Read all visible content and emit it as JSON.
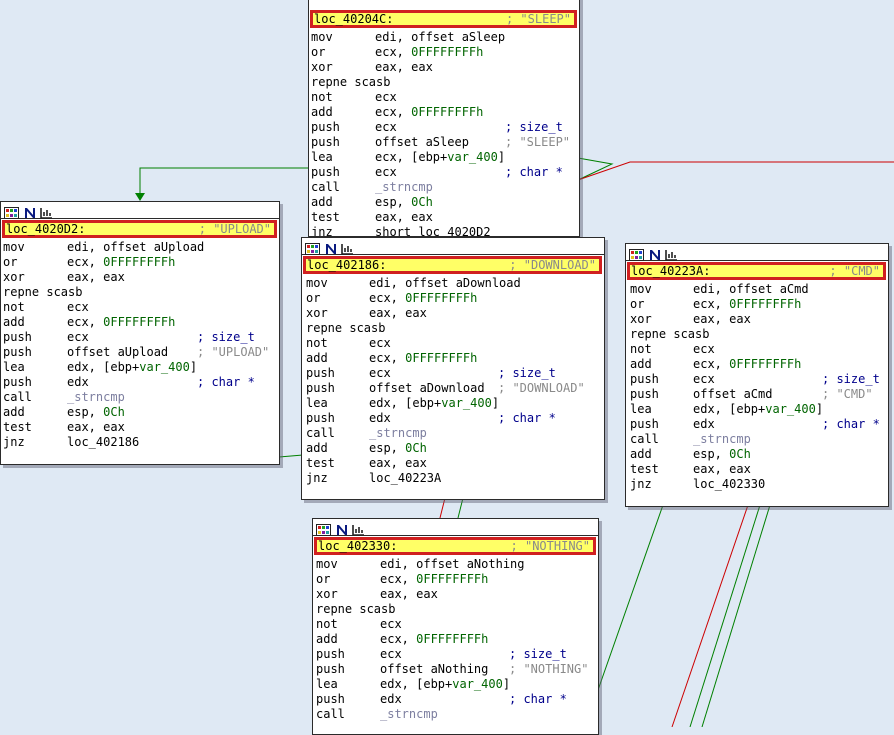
{
  "colors": {
    "background": "#dfe9f4",
    "label_highlight": "#ffff66",
    "label_border": "#d02020",
    "comment": "#8a8a8a",
    "constant": "#006400",
    "function": "#7d7fa0",
    "edge_true": "#008000",
    "edge_false": "#cc0000"
  },
  "header_icons": [
    "palette-icon",
    "n-icon",
    "graph-icon"
  ],
  "nodes": {
    "sleep": {
      "label": "loc_40204C:",
      "comment": "; \"SLEEP\"",
      "lines": [
        {
          "mn": "mov",
          "op": "edi, offset aSleep",
          "cm": ""
        },
        {
          "mn": "or",
          "op": "ecx, 0FFFFFFFFh",
          "cm": ""
        },
        {
          "mn": "xor",
          "op": "eax, eax",
          "cm": ""
        },
        {
          "mn": "repne scasb",
          "op": "",
          "cm": ""
        },
        {
          "mn": "not",
          "op": "ecx",
          "cm": ""
        },
        {
          "mn": "add",
          "op": "ecx, 0FFFFFFFFh",
          "cm": ""
        },
        {
          "mn": "push",
          "op": "ecx",
          "cm": "; size_t"
        },
        {
          "mn": "push",
          "op": "offset aSleep",
          "cm": "; \"SLEEP\""
        },
        {
          "mn": "lea",
          "op": "ecx, [ebp+var_400]",
          "cm": ""
        },
        {
          "mn": "push",
          "op": "ecx",
          "cm": "; char *"
        },
        {
          "mn": "call",
          "op": "_strncmp",
          "cm": ""
        },
        {
          "mn": "add",
          "op": "esp, 0Ch",
          "cm": ""
        },
        {
          "mn": "test",
          "op": "eax, eax",
          "cm": ""
        },
        {
          "mn": "jnz",
          "op": "short loc_4020D2",
          "cm": ""
        }
      ]
    },
    "upload": {
      "label": "loc_4020D2:",
      "comment": "; \"UPLOAD\"",
      "lines": [
        {
          "mn": "mov",
          "op": "edi, offset aUpload",
          "cm": ""
        },
        {
          "mn": "or",
          "op": "ecx, 0FFFFFFFFh",
          "cm": ""
        },
        {
          "mn": "xor",
          "op": "eax, eax",
          "cm": ""
        },
        {
          "mn": "repne scasb",
          "op": "",
          "cm": ""
        },
        {
          "mn": "not",
          "op": "ecx",
          "cm": ""
        },
        {
          "mn": "add",
          "op": "ecx, 0FFFFFFFFh",
          "cm": ""
        },
        {
          "mn": "push",
          "op": "ecx",
          "cm": "; size_t"
        },
        {
          "mn": "push",
          "op": "offset aUpload",
          "cm": "; \"UPLOAD\""
        },
        {
          "mn": "lea",
          "op": "edx, [ebp+var_400]",
          "cm": ""
        },
        {
          "mn": "push",
          "op": "edx",
          "cm": "; char *"
        },
        {
          "mn": "call",
          "op": "_strncmp",
          "cm": ""
        },
        {
          "mn": "add",
          "op": "esp, 0Ch",
          "cm": ""
        },
        {
          "mn": "test",
          "op": "eax, eax",
          "cm": ""
        },
        {
          "mn": "jnz",
          "op": "loc_402186",
          "cm": ""
        }
      ]
    },
    "download": {
      "label": "loc_402186:",
      "comment": "; \"DOWNLOAD\"",
      "lines": [
        {
          "mn": "mov",
          "op": "edi, offset aDownload",
          "cm": ""
        },
        {
          "mn": "or",
          "op": "ecx, 0FFFFFFFFh",
          "cm": ""
        },
        {
          "mn": "xor",
          "op": "eax, eax",
          "cm": ""
        },
        {
          "mn": "repne scasb",
          "op": "",
          "cm": ""
        },
        {
          "mn": "not",
          "op": "ecx",
          "cm": ""
        },
        {
          "mn": "add",
          "op": "ecx, 0FFFFFFFFh",
          "cm": ""
        },
        {
          "mn": "push",
          "op": "ecx",
          "cm": "; size_t"
        },
        {
          "mn": "push",
          "op": "offset aDownload",
          "cm": "; \"DOWNLOAD\""
        },
        {
          "mn": "lea",
          "op": "edx, [ebp+var_400]",
          "cm": ""
        },
        {
          "mn": "push",
          "op": "edx",
          "cm": "; char *"
        },
        {
          "mn": "call",
          "op": "_strncmp",
          "cm": ""
        },
        {
          "mn": "add",
          "op": "esp, 0Ch",
          "cm": ""
        },
        {
          "mn": "test",
          "op": "eax, eax",
          "cm": ""
        },
        {
          "mn": "jnz",
          "op": "loc_40223A",
          "cm": ""
        }
      ]
    },
    "cmd": {
      "label": "loc_40223A:",
      "comment": "; \"CMD\"",
      "lines": [
        {
          "mn": "mov",
          "op": "edi, offset aCmd",
          "cm": ""
        },
        {
          "mn": "or",
          "op": "ecx, 0FFFFFFFFh",
          "cm": ""
        },
        {
          "mn": "xor",
          "op": "eax, eax",
          "cm": ""
        },
        {
          "mn": "repne scasb",
          "op": "",
          "cm": ""
        },
        {
          "mn": "not",
          "op": "ecx",
          "cm": ""
        },
        {
          "mn": "add",
          "op": "ecx, 0FFFFFFFFh",
          "cm": ""
        },
        {
          "mn": "push",
          "op": "ecx",
          "cm": "; size_t"
        },
        {
          "mn": "push",
          "op": "offset aCmd",
          "cm": "; \"CMD\""
        },
        {
          "mn": "lea",
          "op": "edx, [ebp+var_400]",
          "cm": ""
        },
        {
          "mn": "push",
          "op": "edx",
          "cm": "; char *"
        },
        {
          "mn": "call",
          "op": "_strncmp",
          "cm": ""
        },
        {
          "mn": "add",
          "op": "esp, 0Ch",
          "cm": ""
        },
        {
          "mn": "test",
          "op": "eax, eax",
          "cm": ""
        },
        {
          "mn": "jnz",
          "op": "loc_402330",
          "cm": ""
        }
      ]
    },
    "nothing": {
      "label": "loc_402330:",
      "comment": "; \"NOTHING\"",
      "lines": [
        {
          "mn": "mov",
          "op": "edi, offset aNothing",
          "cm": ""
        },
        {
          "mn": "or",
          "op": "ecx, 0FFFFFFFFh",
          "cm": ""
        },
        {
          "mn": "xor",
          "op": "eax, eax",
          "cm": ""
        },
        {
          "mn": "repne scasb",
          "op": "",
          "cm": ""
        },
        {
          "mn": "not",
          "op": "ecx",
          "cm": ""
        },
        {
          "mn": "add",
          "op": "ecx, 0FFFFFFFFh",
          "cm": ""
        },
        {
          "mn": "push",
          "op": "ecx",
          "cm": "; size_t"
        },
        {
          "mn": "push",
          "op": "offset aNothing",
          "cm": "; \"NOTHING\""
        },
        {
          "mn": "lea",
          "op": "edx, [ebp+var_400]",
          "cm": ""
        },
        {
          "mn": "push",
          "op": "edx",
          "cm": "; char *"
        },
        {
          "mn": "call",
          "op": "_strncmp",
          "cm": ""
        }
      ]
    }
  }
}
